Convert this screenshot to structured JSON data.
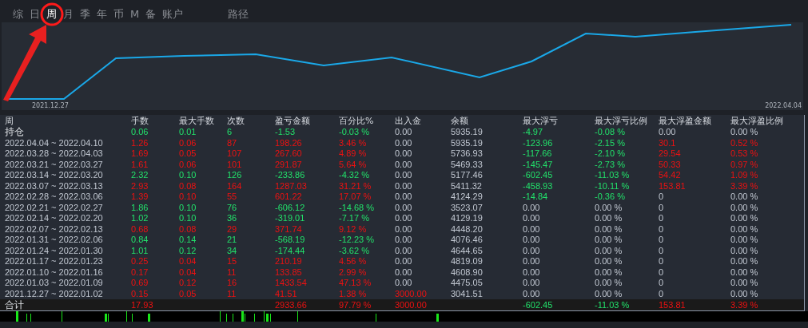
{
  "tabs": [
    {
      "label": "综",
      "selected": false
    },
    {
      "label": "日",
      "selected": false
    },
    {
      "label": "周",
      "selected": true
    },
    {
      "label": "月",
      "selected": false
    },
    {
      "label": "季",
      "selected": false
    },
    {
      "label": "年",
      "selected": false
    },
    {
      "label": "币",
      "selected": false
    },
    {
      "label": "M",
      "selected": false
    },
    {
      "label": "备",
      "selected": false
    },
    {
      "label": "账户",
      "selected": false
    },
    {
      "label": "路径",
      "selected": false
    }
  ],
  "chart": {
    "x_start_label": "2021.12.27",
    "x_end_label": "2022.04.04"
  },
  "table": {
    "columns": [
      "周",
      "手数",
      "最大手数",
      "次数",
      "盈亏金额",
      "百分比%",
      "出入金",
      "余额",
      "最大浮亏",
      "最大浮亏比例",
      "最大浮盈金额",
      "最大浮盈比例"
    ],
    "rows": [
      {
        "cells": [
          {
            "text": "持仓",
            "kind": "label"
          },
          {
            "text": "0.06",
            "kind": "down"
          },
          {
            "text": "0.01",
            "kind": "down"
          },
          {
            "text": "6",
            "kind": "down"
          },
          {
            "text": "-1.53",
            "kind": "down"
          },
          {
            "text": "-0.03 %",
            "kind": "down"
          },
          {
            "text": "0.00",
            "kind": "flat"
          },
          {
            "text": "5935.19",
            "kind": "flat"
          },
          {
            "text": "-4.97",
            "kind": "down"
          },
          {
            "text": "-0.08 %",
            "kind": "down"
          },
          {
            "text": "0.00",
            "kind": "flat"
          },
          {
            "text": "0.00 %",
            "kind": "flat"
          }
        ]
      },
      {
        "cells": [
          {
            "text": "2022.04.04 ~ 2022.04.10",
            "kind": "flat"
          },
          {
            "text": "1.26",
            "kind": "up"
          },
          {
            "text": "0.06",
            "kind": "up"
          },
          {
            "text": "87",
            "kind": "up"
          },
          {
            "text": "198.26",
            "kind": "up"
          },
          {
            "text": "3.46 %",
            "kind": "up"
          },
          {
            "text": "0.00",
            "kind": "flat"
          },
          {
            "text": "5935.19",
            "kind": "flat"
          },
          {
            "text": "-123.96",
            "kind": "down"
          },
          {
            "text": "-2.15 %",
            "kind": "down"
          },
          {
            "text": "30.1",
            "kind": "up"
          },
          {
            "text": "0.52 %",
            "kind": "up"
          }
        ]
      },
      {
        "cells": [
          {
            "text": "2022.03.28 ~ 2022.04.03",
            "kind": "flat"
          },
          {
            "text": "1.69",
            "kind": "up"
          },
          {
            "text": "0.05",
            "kind": "up"
          },
          {
            "text": "107",
            "kind": "up"
          },
          {
            "text": "267.60",
            "kind": "up"
          },
          {
            "text": "4.89 %",
            "kind": "up"
          },
          {
            "text": "0.00",
            "kind": "flat"
          },
          {
            "text": "5736.93",
            "kind": "flat"
          },
          {
            "text": "-117.66",
            "kind": "down"
          },
          {
            "text": "-2.10 %",
            "kind": "down"
          },
          {
            "text": "29.54",
            "kind": "up"
          },
          {
            "text": "0.53 %",
            "kind": "up"
          }
        ]
      },
      {
        "cells": [
          {
            "text": "2022.03.21 ~ 2022.03.27",
            "kind": "flat"
          },
          {
            "text": "1.61",
            "kind": "up"
          },
          {
            "text": "0.06",
            "kind": "up"
          },
          {
            "text": "101",
            "kind": "up"
          },
          {
            "text": "291.87",
            "kind": "up"
          },
          {
            "text": "5.64 %",
            "kind": "up"
          },
          {
            "text": "0.00",
            "kind": "flat"
          },
          {
            "text": "5469.33",
            "kind": "flat"
          },
          {
            "text": "-145.47",
            "kind": "down"
          },
          {
            "text": "-2.73 %",
            "kind": "down"
          },
          {
            "text": "50.33",
            "kind": "up"
          },
          {
            "text": "0.97 %",
            "kind": "up"
          }
        ]
      },
      {
        "cells": [
          {
            "text": "2022.03.14 ~ 2022.03.20",
            "kind": "flat"
          },
          {
            "text": "2.32",
            "kind": "down"
          },
          {
            "text": "0.10",
            "kind": "down"
          },
          {
            "text": "126",
            "kind": "down"
          },
          {
            "text": "-233.86",
            "kind": "down"
          },
          {
            "text": "-4.32 %",
            "kind": "down"
          },
          {
            "text": "0.00",
            "kind": "flat"
          },
          {
            "text": "5177.46",
            "kind": "flat"
          },
          {
            "text": "-602.45",
            "kind": "down"
          },
          {
            "text": "-11.03 %",
            "kind": "down"
          },
          {
            "text": "54.42",
            "kind": "up"
          },
          {
            "text": "1.09 %",
            "kind": "up"
          }
        ]
      },
      {
        "cells": [
          {
            "text": "2022.03.07 ~ 2022.03.13",
            "kind": "flat"
          },
          {
            "text": "2.93",
            "kind": "up"
          },
          {
            "text": "0.08",
            "kind": "up"
          },
          {
            "text": "164",
            "kind": "up"
          },
          {
            "text": "1287.03",
            "kind": "up"
          },
          {
            "text": "31.21 %",
            "kind": "up"
          },
          {
            "text": "0.00",
            "kind": "flat"
          },
          {
            "text": "5411.32",
            "kind": "flat"
          },
          {
            "text": "-458.93",
            "kind": "down"
          },
          {
            "text": "-10.11 %",
            "kind": "down"
          },
          {
            "text": "153.81",
            "kind": "up"
          },
          {
            "text": "3.39 %",
            "kind": "up"
          }
        ]
      },
      {
        "cells": [
          {
            "text": "2022.02.28 ~ 2022.03.06",
            "kind": "flat"
          },
          {
            "text": "1.39",
            "kind": "up"
          },
          {
            "text": "0.10",
            "kind": "up"
          },
          {
            "text": "55",
            "kind": "up"
          },
          {
            "text": "601.22",
            "kind": "up"
          },
          {
            "text": "17.07 %",
            "kind": "up"
          },
          {
            "text": "0.00",
            "kind": "flat"
          },
          {
            "text": "4124.29",
            "kind": "flat"
          },
          {
            "text": "-14.84",
            "kind": "down"
          },
          {
            "text": "-0.36 %",
            "kind": "down"
          },
          {
            "text": "0",
            "kind": "flat"
          },
          {
            "text": "0.00 %",
            "kind": "flat"
          }
        ]
      },
      {
        "cells": [
          {
            "text": "2022.02.21 ~ 2022.02.27",
            "kind": "flat"
          },
          {
            "text": "1.86",
            "kind": "down"
          },
          {
            "text": "0.10",
            "kind": "down"
          },
          {
            "text": "76",
            "kind": "down"
          },
          {
            "text": "-606.12",
            "kind": "down"
          },
          {
            "text": "-14.68 %",
            "kind": "down"
          },
          {
            "text": "0.00",
            "kind": "flat"
          },
          {
            "text": "3523.07",
            "kind": "flat"
          },
          {
            "text": "0.00",
            "kind": "flat"
          },
          {
            "text": "0.00 %",
            "kind": "flat"
          },
          {
            "text": "0",
            "kind": "flat"
          },
          {
            "text": "0.00 %",
            "kind": "flat"
          }
        ]
      },
      {
        "cells": [
          {
            "text": "2022.02.14 ~ 2022.02.20",
            "kind": "flat"
          },
          {
            "text": "1.02",
            "kind": "down"
          },
          {
            "text": "0.10",
            "kind": "down"
          },
          {
            "text": "36",
            "kind": "down"
          },
          {
            "text": "-319.01",
            "kind": "down"
          },
          {
            "text": "-7.17 %",
            "kind": "down"
          },
          {
            "text": "0.00",
            "kind": "flat"
          },
          {
            "text": "4129.19",
            "kind": "flat"
          },
          {
            "text": "0.00",
            "kind": "flat"
          },
          {
            "text": "0.00 %",
            "kind": "flat"
          },
          {
            "text": "0",
            "kind": "flat"
          },
          {
            "text": "0.00 %",
            "kind": "flat"
          }
        ]
      },
      {
        "cells": [
          {
            "text": "2022.02.07 ~ 2022.02.13",
            "kind": "flat"
          },
          {
            "text": "0.68",
            "kind": "up"
          },
          {
            "text": "0.08",
            "kind": "up"
          },
          {
            "text": "29",
            "kind": "up"
          },
          {
            "text": "371.74",
            "kind": "up"
          },
          {
            "text": "9.12 %",
            "kind": "up"
          },
          {
            "text": "0.00",
            "kind": "flat"
          },
          {
            "text": "4448.20",
            "kind": "flat"
          },
          {
            "text": "0.00",
            "kind": "flat"
          },
          {
            "text": "0.00 %",
            "kind": "flat"
          },
          {
            "text": "0",
            "kind": "flat"
          },
          {
            "text": "0.00 %",
            "kind": "flat"
          }
        ]
      },
      {
        "cells": [
          {
            "text": "2022.01.31 ~ 2022.02.06",
            "kind": "flat"
          },
          {
            "text": "0.84",
            "kind": "down"
          },
          {
            "text": "0.14",
            "kind": "down"
          },
          {
            "text": "21",
            "kind": "down"
          },
          {
            "text": "-568.19",
            "kind": "down"
          },
          {
            "text": "-12.23 %",
            "kind": "down"
          },
          {
            "text": "0.00",
            "kind": "flat"
          },
          {
            "text": "4076.46",
            "kind": "flat"
          },
          {
            "text": "0.00",
            "kind": "flat"
          },
          {
            "text": "0.00 %",
            "kind": "flat"
          },
          {
            "text": "0",
            "kind": "flat"
          },
          {
            "text": "0.00 %",
            "kind": "flat"
          }
        ]
      },
      {
        "cells": [
          {
            "text": "2022.01.24 ~ 2022.01.30",
            "kind": "flat"
          },
          {
            "text": "1.01",
            "kind": "down"
          },
          {
            "text": "0.12",
            "kind": "down"
          },
          {
            "text": "34",
            "kind": "down"
          },
          {
            "text": "-174.44",
            "kind": "down"
          },
          {
            "text": "-3.62 %",
            "kind": "down"
          },
          {
            "text": "0.00",
            "kind": "flat"
          },
          {
            "text": "4644.65",
            "kind": "flat"
          },
          {
            "text": "0.00",
            "kind": "flat"
          },
          {
            "text": "0.00 %",
            "kind": "flat"
          },
          {
            "text": "0",
            "kind": "flat"
          },
          {
            "text": "0.00 %",
            "kind": "flat"
          }
        ]
      },
      {
        "cells": [
          {
            "text": "2022.01.17 ~ 2022.01.23",
            "kind": "flat"
          },
          {
            "text": "0.25",
            "kind": "up"
          },
          {
            "text": "0.04",
            "kind": "up"
          },
          {
            "text": "15",
            "kind": "up"
          },
          {
            "text": "210.19",
            "kind": "up"
          },
          {
            "text": "4.56 %",
            "kind": "up"
          },
          {
            "text": "0.00",
            "kind": "flat"
          },
          {
            "text": "4819.09",
            "kind": "flat"
          },
          {
            "text": "0.00",
            "kind": "flat"
          },
          {
            "text": "0.00 %",
            "kind": "flat"
          },
          {
            "text": "0",
            "kind": "flat"
          },
          {
            "text": "0.00 %",
            "kind": "flat"
          }
        ]
      },
      {
        "cells": [
          {
            "text": "2022.01.10 ~ 2022.01.16",
            "kind": "flat"
          },
          {
            "text": "0.17",
            "kind": "up"
          },
          {
            "text": "0.04",
            "kind": "up"
          },
          {
            "text": "11",
            "kind": "up"
          },
          {
            "text": "133.85",
            "kind": "up"
          },
          {
            "text": "2.99 %",
            "kind": "up"
          },
          {
            "text": "0.00",
            "kind": "flat"
          },
          {
            "text": "4608.90",
            "kind": "flat"
          },
          {
            "text": "0.00",
            "kind": "flat"
          },
          {
            "text": "0.00 %",
            "kind": "flat"
          },
          {
            "text": "0",
            "kind": "flat"
          },
          {
            "text": "0.00 %",
            "kind": "flat"
          }
        ]
      },
      {
        "cells": [
          {
            "text": "2022.01.03 ~ 2022.01.09",
            "kind": "flat"
          },
          {
            "text": "0.69",
            "kind": "up"
          },
          {
            "text": "0.12",
            "kind": "up"
          },
          {
            "text": "16",
            "kind": "up"
          },
          {
            "text": "1433.54",
            "kind": "up"
          },
          {
            "text": "47.13 %",
            "kind": "up"
          },
          {
            "text": "0.00",
            "kind": "flat"
          },
          {
            "text": "4475.05",
            "kind": "flat"
          },
          {
            "text": "0.00",
            "kind": "flat"
          },
          {
            "text": "0.00 %",
            "kind": "flat"
          },
          {
            "text": "0",
            "kind": "flat"
          },
          {
            "text": "0.00 %",
            "kind": "flat"
          }
        ]
      },
      {
        "cells": [
          {
            "text": "2021.12.27 ~ 2022.01.02",
            "kind": "flat"
          },
          {
            "text": "0.15",
            "kind": "up"
          },
          {
            "text": "0.05",
            "kind": "up"
          },
          {
            "text": "11",
            "kind": "up"
          },
          {
            "text": "41.51",
            "kind": "up"
          },
          {
            "text": "1.38 %",
            "kind": "up"
          },
          {
            "text": "3000.00",
            "kind": "up"
          },
          {
            "text": "3041.51",
            "kind": "flat"
          },
          {
            "text": "0.00",
            "kind": "flat"
          },
          {
            "text": "0.00 %",
            "kind": "flat"
          },
          {
            "text": "0",
            "kind": "flat"
          },
          {
            "text": "0.00 %",
            "kind": "flat"
          }
        ]
      }
    ],
    "total": [
      {
        "text": "合计",
        "kind": "label"
      },
      {
        "text": "17.93",
        "kind": "up"
      },
      {
        "kind": "flat"
      },
      {
        "kind": "flat"
      },
      {
        "text": "2933.66",
        "kind": "up"
      },
      {
        "text": "97.79 %",
        "kind": "up"
      },
      {
        "text": "3000.00",
        "kind": "up"
      },
      {
        "kind": "flat"
      },
      {
        "text": "-602.45",
        "kind": "down"
      },
      {
        "text": "-11.03 %",
        "kind": "down"
      },
      {
        "text": "153.81",
        "kind": "up"
      },
      {
        "text": "3.39 %",
        "kind": "up"
      }
    ]
  }
}
